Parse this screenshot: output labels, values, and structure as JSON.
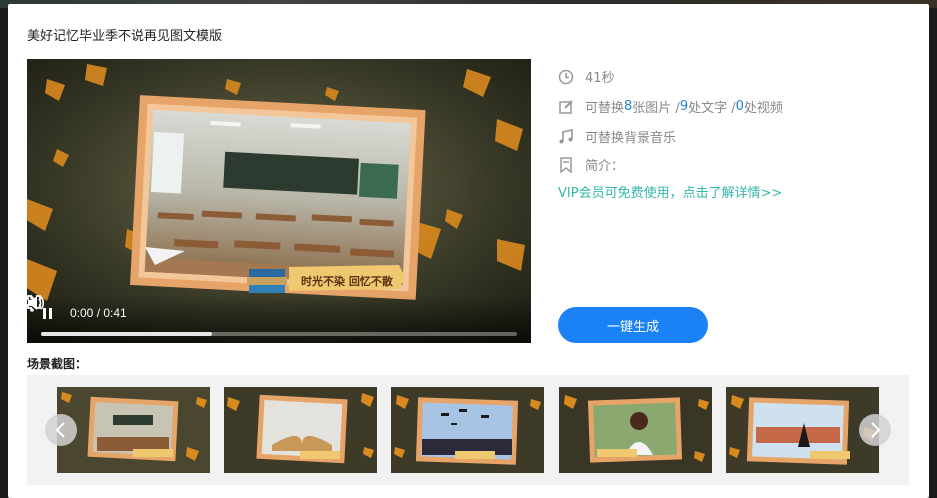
{
  "modal": {
    "title": "美好记忆毕业季不说再见图文模版"
  },
  "player": {
    "time_display": "0:00 / 0:41",
    "progress": 0.36,
    "banner_text": "时光不染 回忆不散"
  },
  "info": {
    "duration": "41秒",
    "replace_prefix": "可替换",
    "images_count": "8",
    "images_label": "张图片 / ",
    "texts_count": "9",
    "texts_label": "处文字 / ",
    "videos_count": "0",
    "videos_label": "处视频",
    "music": "可替换背景音乐",
    "intro_label": "简介：",
    "vip_link": "VIP会员可免费使用，点击了解详情>>",
    "icons": [
      "clock-icon",
      "edit-icon",
      "music-note-icon",
      "bookmark-icon"
    ]
  },
  "generate_button": "一键生成",
  "scenes": {
    "label": "场景截图：",
    "items": [
      {
        "name": "classroom-scene"
      },
      {
        "name": "open-book-scene"
      },
      {
        "name": "caps-toss-scene"
      },
      {
        "name": "graduate-portrait-scene"
      },
      {
        "name": "campus-gate-scene"
      }
    ]
  },
  "colors": {
    "accent": "#1a82f5",
    "link": "#32b8a8",
    "number": "#1b83d6"
  }
}
